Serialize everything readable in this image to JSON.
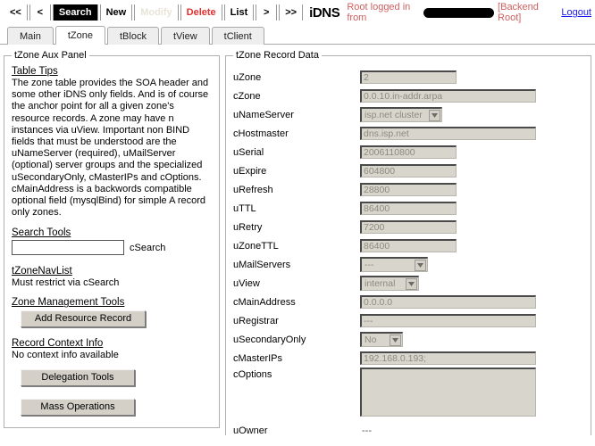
{
  "toolbar": {
    "buttons": [
      {
        "label": "<<",
        "state": "normal"
      },
      {
        "label": "<",
        "state": "normal"
      },
      {
        "label": "Search",
        "state": "active"
      },
      {
        "label": "New",
        "state": "normal"
      },
      {
        "label": "Modify",
        "state": "disabled"
      },
      {
        "label": "Delete",
        "state": "danger"
      },
      {
        "label": "List",
        "state": "normal"
      },
      {
        "label": ">",
        "state": "normal"
      },
      {
        "label": ">>",
        "state": "normal"
      }
    ],
    "brand": "iDNS",
    "login_text": "Root logged in from",
    "role_text": "[Backend Root]",
    "logout_label": "Logout",
    "colors": {
      "active_bg": "#000000",
      "danger": "#e03030",
      "login_text": "#d06060",
      "link": "#1a1aee"
    }
  },
  "tabs": [
    {
      "label": "Main",
      "active": false
    },
    {
      "label": "tZone",
      "active": true
    },
    {
      "label": "tBlock",
      "active": false
    },
    {
      "label": "tView",
      "active": false
    },
    {
      "label": "tClient",
      "active": false
    }
  ],
  "aux_panel": {
    "legend": "tZone Aux Panel",
    "tips_heading": "Table Tips",
    "tips_text": "The zone table provides the SOA header and some other iDNS only fields. And is of course the anchor point for all a given zone's resource records. A zone may have n instances via uView. Important non BIND fields that must be understood are the uNameServer (required), uMailServer (optional) server groups and the specialized uSecondaryOnly, cMasterIPs and cOptions. cMainAddress is a backwords compatible optional field (mysqlBind) for simple A record only zones.",
    "search_heading": "Search Tools",
    "search_value": "",
    "search_placeholder": "",
    "search_label": "cSearch",
    "navlist_heading": "tZoneNavList",
    "navlist_text": "Must restrict via cSearch",
    "zone_mgmt_heading": "Zone Management Tools",
    "add_rr_label": "Add Resource Record",
    "context_heading": "Record Context Info",
    "context_text": "No context info available",
    "delegation_label": "Delegation Tools",
    "mass_label": "Mass Operations"
  },
  "record_panel": {
    "legend": "tZone Record Data",
    "fields": [
      {
        "label": "uZone",
        "type": "text",
        "value": "2",
        "width": "w-short"
      },
      {
        "label": "cZone",
        "type": "text",
        "value": "0.0.10.in-addr.arpa",
        "width": "w-long"
      },
      {
        "label": "uNameServer",
        "type": "select",
        "value": "isp.net cluster",
        "width": "sel-ns"
      },
      {
        "label": "cHostmaster",
        "type": "text",
        "value": "dns.isp.net",
        "width": "w-long"
      },
      {
        "label": "uSerial",
        "type": "text",
        "value": "2006110800",
        "width": "w-short"
      },
      {
        "label": "uExpire",
        "type": "text",
        "value": "604800",
        "width": "w-short"
      },
      {
        "label": "uRefresh",
        "type": "text",
        "value": "28800",
        "width": "w-short"
      },
      {
        "label": "uTTL",
        "type": "text",
        "value": "86400",
        "width": "w-short"
      },
      {
        "label": "uRetry",
        "type": "text",
        "value": "7200",
        "width": "w-short"
      },
      {
        "label": "uZoneTTL",
        "type": "text",
        "value": "86400",
        "width": "w-short"
      },
      {
        "label": "uMailServers",
        "type": "select",
        "value": "---",
        "width": "sel-ms"
      },
      {
        "label": "uView",
        "type": "select",
        "value": "internal",
        "width": "sel-vw"
      },
      {
        "label": "cMainAddress",
        "type": "text",
        "value": "0.0.0.0",
        "width": "w-long"
      },
      {
        "label": "uRegistrar",
        "type": "text",
        "value": "---",
        "width": "w-long"
      },
      {
        "label": "uSecondaryOnly",
        "type": "select",
        "value": "No",
        "width": "sel-so"
      },
      {
        "label": "cMasterIPs",
        "type": "text",
        "value": "192.168.0.193;",
        "width": "w-long"
      },
      {
        "label": "cOptions",
        "type": "textarea",
        "value": "",
        "width": "w-long"
      },
      {
        "label": "uOwner",
        "type": "static",
        "value": "---",
        "width": ""
      }
    ]
  }
}
